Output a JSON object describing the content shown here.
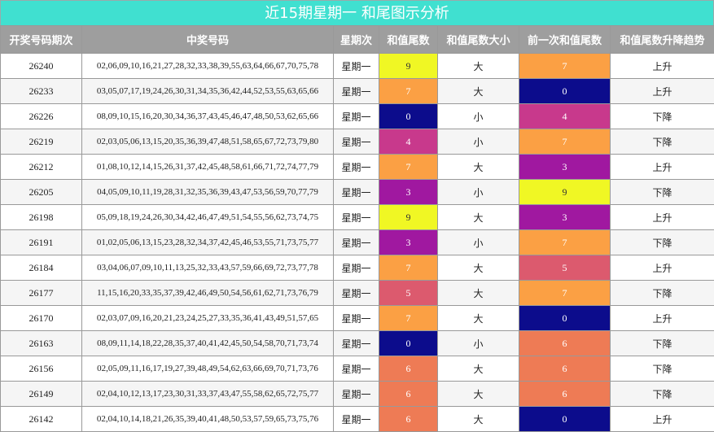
{
  "title": "近15期星期一 和尾图示分析",
  "columns": [
    "开奖号码期次",
    "中奖号码",
    "星期次",
    "和值尾数",
    "和值尾数大小",
    "前一次和值尾数",
    "和值尾数升降趋势"
  ],
  "colors": {
    "0": "#0c0c8c",
    "3": "#a018a0",
    "4": "#c8398c",
    "5": "#dc5a6e",
    "6": "#ee7b55",
    "7": "#fba044",
    "9": "#f0f724"
  },
  "rows": [
    {
      "issue": "26240",
      "numbers": "02,06,09,10,16,21,27,28,32,33,38,39,55,63,64,66,67,70,75,78",
      "weekday": "星期一",
      "tail": "9",
      "size": "大",
      "prev_tail": "7",
      "trend": "上升"
    },
    {
      "issue": "26233",
      "numbers": "03,05,07,17,19,24,26,30,31,34,35,36,42,44,52,53,55,63,65,66",
      "weekday": "星期一",
      "tail": "7",
      "size": "大",
      "prev_tail": "0",
      "trend": "上升"
    },
    {
      "issue": "26226",
      "numbers": "08,09,10,15,16,20,30,34,36,37,43,45,46,47,48,50,53,62,65,66",
      "weekday": "星期一",
      "tail": "0",
      "size": "小",
      "prev_tail": "4",
      "trend": "下降"
    },
    {
      "issue": "26219",
      "numbers": "02,03,05,06,13,15,20,35,36,39,47,48,51,58,65,67,72,73,79,80",
      "weekday": "星期一",
      "tail": "4",
      "size": "小",
      "prev_tail": "7",
      "trend": "下降"
    },
    {
      "issue": "26212",
      "numbers": "01,08,10,12,14,15,26,31,37,42,45,48,58,61,66,71,72,74,77,79",
      "weekday": "星期一",
      "tail": "7",
      "size": "大",
      "prev_tail": "3",
      "trend": "上升"
    },
    {
      "issue": "26205",
      "numbers": "04,05,09,10,11,19,28,31,32,35,36,39,43,47,53,56,59,70,77,79",
      "weekday": "星期一",
      "tail": "3",
      "size": "小",
      "prev_tail": "9",
      "trend": "下降"
    },
    {
      "issue": "26198",
      "numbers": "05,09,18,19,24,26,30,34,42,46,47,49,51,54,55,56,62,73,74,75",
      "weekday": "星期一",
      "tail": "9",
      "size": "大",
      "prev_tail": "3",
      "trend": "上升"
    },
    {
      "issue": "26191",
      "numbers": "01,02,05,06,13,15,23,28,32,34,37,42,45,46,53,55,71,73,75,77",
      "weekday": "星期一",
      "tail": "3",
      "size": "小",
      "prev_tail": "7",
      "trend": "下降"
    },
    {
      "issue": "26184",
      "numbers": "03,04,06,07,09,10,11,13,25,32,33,43,57,59,66,69,72,73,77,78",
      "weekday": "星期一",
      "tail": "7",
      "size": "大",
      "prev_tail": "5",
      "trend": "上升"
    },
    {
      "issue": "26177",
      "numbers": "11,15,16,20,33,35,37,39,42,46,49,50,54,56,61,62,71,73,76,79",
      "weekday": "星期一",
      "tail": "5",
      "size": "大",
      "prev_tail": "7",
      "trend": "下降"
    },
    {
      "issue": "26170",
      "numbers": "02,03,07,09,16,20,21,23,24,25,27,33,35,36,41,43,49,51,57,65",
      "weekday": "星期一",
      "tail": "7",
      "size": "大",
      "prev_tail": "0",
      "trend": "上升"
    },
    {
      "issue": "26163",
      "numbers": "08,09,11,14,18,22,28,35,37,40,41,42,45,50,54,58,70,71,73,74",
      "weekday": "星期一",
      "tail": "0",
      "size": "小",
      "prev_tail": "6",
      "trend": "下降"
    },
    {
      "issue": "26156",
      "numbers": "02,05,09,11,16,17,19,27,39,48,49,54,62,63,66,69,70,71,73,76",
      "weekday": "星期一",
      "tail": "6",
      "size": "大",
      "prev_tail": "6",
      "trend": "下降"
    },
    {
      "issue": "26149",
      "numbers": "02,04,10,12,13,17,23,30,31,33,37,43,47,55,58,62,65,72,75,77",
      "weekday": "星期一",
      "tail": "6",
      "size": "大",
      "prev_tail": "6",
      "trend": "下降"
    },
    {
      "issue": "26142",
      "numbers": "02,04,10,14,18,21,26,35,39,40,41,48,50,53,57,59,65,73,75,76",
      "weekday": "星期一",
      "tail": "6",
      "size": "大",
      "prev_tail": "0",
      "trend": "上升"
    }
  ]
}
